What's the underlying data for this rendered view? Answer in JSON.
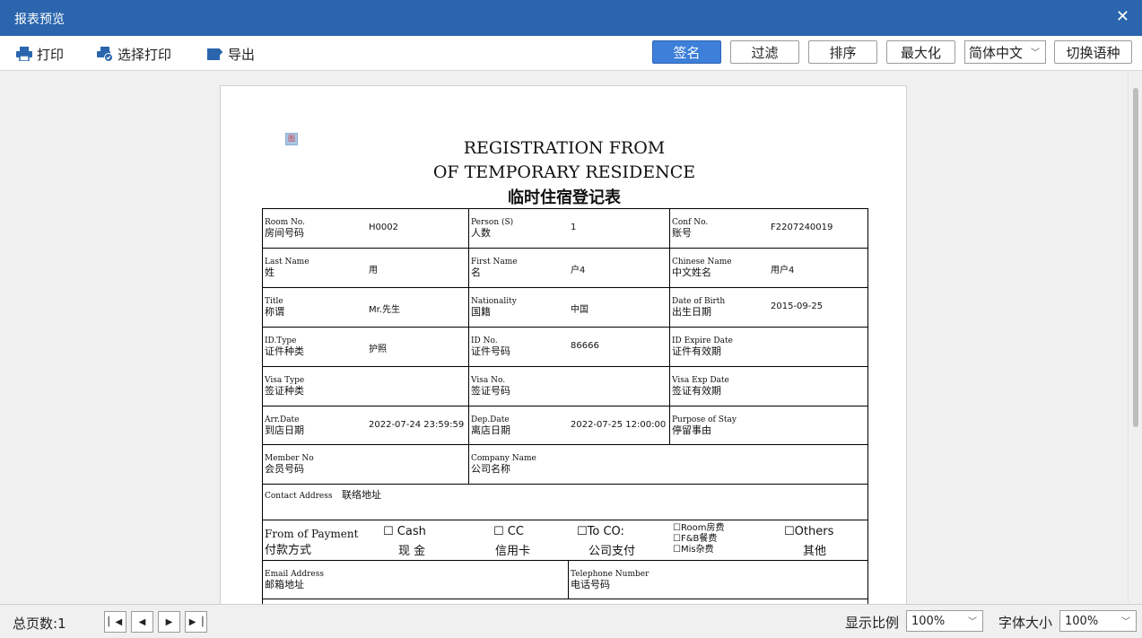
{
  "window": {
    "title": "报表预览"
  },
  "toolbar": {
    "print": "打印",
    "select_print": "选择打印",
    "export": "导出",
    "sign": "签名",
    "filter": "过滤",
    "sort": "排序",
    "maximize": "最大化",
    "language": "简体中文",
    "switch_language": "切换语种"
  },
  "report": {
    "marker": "图",
    "title1": "REGISTRATION FROM",
    "title2": "OF TEMPORARY RESIDENCE",
    "title3": "临时住宿登记表",
    "rows": [
      [
        {
          "en": "Room No.",
          "cn": "房间号码",
          "value": "H0002"
        },
        {
          "en": "Person (S)",
          "cn": "人数",
          "value": "1"
        },
        {
          "en": "Conf No.",
          "cn": "账号",
          "value": "F2207240019"
        }
      ],
      [
        {
          "en": "Last Name",
          "cn": "姓",
          "value": "用"
        },
        {
          "en": "First Name",
          "cn": "名",
          "value": "户4"
        },
        {
          "en": "Chinese Name",
          "cn": "中文姓名",
          "value": "用户4"
        }
      ],
      [
        {
          "en": "Title",
          "cn": "称谓",
          "value": "Mr.先生"
        },
        {
          "en": "Nationality",
          "cn": "国籍",
          "value": "中国"
        },
        {
          "en": "Date of Birth",
          "cn": "出生日期",
          "value": "2015-09-25"
        }
      ],
      [
        {
          "en": "ID.Type",
          "cn": "证件种类",
          "value": "护照"
        },
        {
          "en": "ID No.",
          "cn": "证件号码",
          "value": "86666"
        },
        {
          "en": "ID Expire Date",
          "cn": "证件有效期",
          "value": ""
        }
      ],
      [
        {
          "en": "Visa Type",
          "cn": "签证种类",
          "value": ""
        },
        {
          "en": "Visa No.",
          "cn": "签证号码",
          "value": ""
        },
        {
          "en": "Visa Exp Date",
          "cn": "签证有效期",
          "value": ""
        }
      ],
      [
        {
          "en": "Arr.Date",
          "cn": "到店日期",
          "value": "2022-07-24 23:59:59"
        },
        {
          "en": "Dep.Date",
          "cn": "离店日期",
          "value": "2022-07-25 12:00:00"
        },
        {
          "en": "Purpose of Stay",
          "cn": "停留事由",
          "value": ""
        }
      ]
    ],
    "member": {
      "en": "Member No",
      "cn": "会员号码"
    },
    "company": {
      "en": "Company Name",
      "cn": "公司名称"
    },
    "contact": {
      "en": "Contact Address",
      "cn": "联络地址"
    },
    "payment": {
      "label_en": "From of Payment",
      "label_cn": "付款方式",
      "cash_en": "Cash",
      "cash_cn": "现 金",
      "cc_en": "CC",
      "cc_cn": "信用卡",
      "toco_en": "To CO:",
      "toco_cn": "公司支付",
      "room": "Room房费",
      "fb": "F&B餐费",
      "mis": "Mis杂费",
      "others_en": "Others",
      "others_cn": "其他"
    },
    "email": {
      "en": "Email Address",
      "cn": "邮箱地址"
    },
    "phone": {
      "en": "Telephone Number",
      "cn": "电话号码"
    }
  },
  "status": {
    "total_pages_label": "总页数:",
    "total_pages": "1",
    "zoom_label": "显示比例",
    "zoom_value": "100%",
    "font_label": "字体大小",
    "font_value": "100%"
  }
}
